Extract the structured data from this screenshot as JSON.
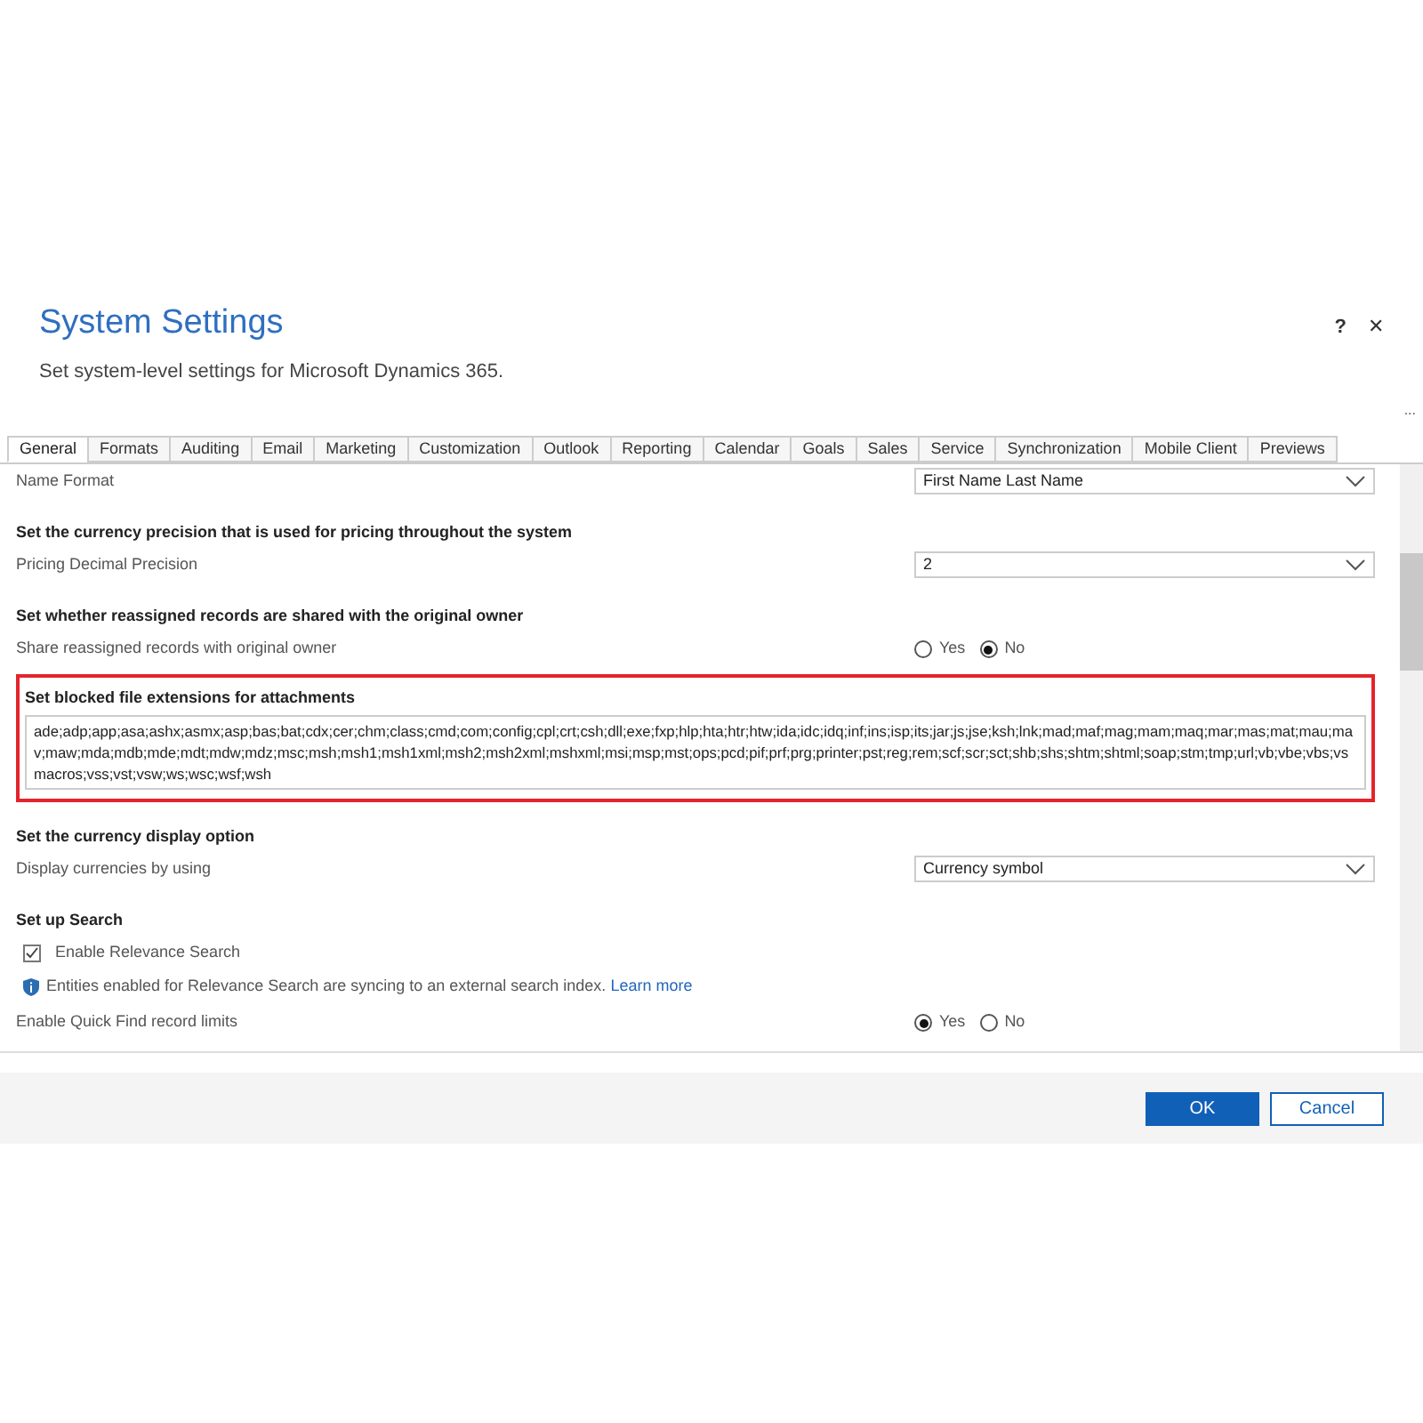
{
  "dialog": {
    "title": "System Settings",
    "subtitle": "Set system-level settings for Microsoft Dynamics 365.",
    "help": "?",
    "close": "✕",
    "more": "..."
  },
  "tabs": [
    {
      "label": "General",
      "selected": true
    },
    {
      "label": "Formats",
      "selected": false
    },
    {
      "label": "Auditing",
      "selected": false
    },
    {
      "label": "Email",
      "selected": false
    },
    {
      "label": "Marketing",
      "selected": false
    },
    {
      "label": "Customization",
      "selected": false
    },
    {
      "label": "Outlook",
      "selected": false
    },
    {
      "label": "Reporting",
      "selected": false
    },
    {
      "label": "Calendar",
      "selected": false
    },
    {
      "label": "Goals",
      "selected": false
    },
    {
      "label": "Sales",
      "selected": false
    },
    {
      "label": "Service",
      "selected": false
    },
    {
      "label": "Synchronization",
      "selected": false
    },
    {
      "label": "Mobile Client",
      "selected": false
    },
    {
      "label": "Previews",
      "selected": false
    }
  ],
  "rows": [
    {
      "kind": "select",
      "label": "Name Format",
      "value": "First Name Last Name"
    },
    {
      "kind": "heading",
      "label": "Set the currency precision that is used for pricing throughout the system"
    },
    {
      "kind": "select",
      "label": "Pricing Decimal Precision",
      "value": "2"
    },
    {
      "kind": "heading",
      "label": "Set whether reassigned records are shared with the original owner"
    },
    {
      "kind": "radio",
      "label": "Share reassigned records with original owner",
      "options": [
        {
          "label": "Yes",
          "selected": false
        },
        {
          "label": "No",
          "selected": true
        }
      ]
    },
    {
      "kind": "textarea",
      "label": "Set blocked file extensions for attachments",
      "value": "ade;adp;app;asa;ashx;asmx;asp;bas;bat;cdx;cer;chm;class;cmd;com;config;cpl;crt;csh;dll;exe;fxp;hlp;hta;htr;htw;ida;idc;idq;inf;ins;isp;its;jar;js;jse;ksh;lnk;mad;maf;mag;mam;maq;mar;mas;mat;mau;mav;maw;mda;mdb;mde;mdt;mdw;mdz;msc;msh;msh1;msh1xml;msh2;msh2xml;mshxml;msi;msp;mst;ops;pcd;pif;prf;prg;printer;pst;reg;rem;scf;scr;sct;shb;shs;shtm;shtml;soap;stm;tmp;url;vb;vbe;vbs;vsmacros;vss;vst;vsw;ws;wsc;wsf;wsh",
      "highlighted": true
    },
    {
      "kind": "heading",
      "label": "Set the currency display option"
    },
    {
      "kind": "select",
      "label": "Display currencies by using",
      "value": "Currency symbol"
    },
    {
      "kind": "heading",
      "label": "Set up Search"
    },
    {
      "kind": "checkbox",
      "label": "Enable Relevance Search",
      "checked": true
    },
    {
      "kind": "info",
      "label": "Entities enabled for Relevance Search are syncing to an external search index.",
      "link": "Learn more"
    },
    {
      "kind": "radio",
      "label": "Enable Quick Find record limits",
      "options": [
        {
          "label": "Yes",
          "selected": true
        },
        {
          "label": "No",
          "selected": false
        }
      ]
    }
  ],
  "buttons": [
    {
      "label": "OK",
      "primary": true
    },
    {
      "label": "Cancel",
      "primary": false
    }
  ]
}
